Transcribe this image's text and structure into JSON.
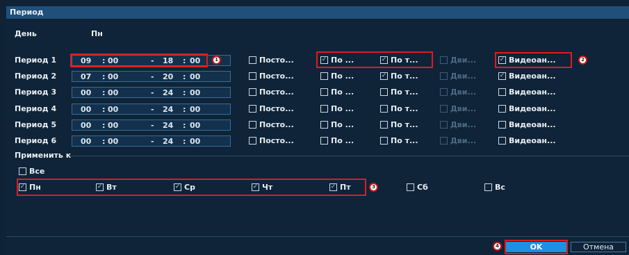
{
  "title": "Период",
  "day": {
    "label": "День",
    "value": "Пн"
  },
  "periods": [
    {
      "label": "Период 1",
      "from_h": "09",
      "from_m": "00",
      "to_h": "18",
      "to_m": "00",
      "checks": [
        false,
        true,
        true,
        false,
        true
      ]
    },
    {
      "label": "Период 2",
      "from_h": "07",
      "from_m": "00",
      "to_h": "20",
      "to_m": "00",
      "checks": [
        false,
        false,
        true,
        false,
        true
      ]
    },
    {
      "label": "Период 3",
      "from_h": "00",
      "from_m": "00",
      "to_h": "24",
      "to_m": "00",
      "checks": [
        false,
        false,
        false,
        false,
        false
      ]
    },
    {
      "label": "Период 4",
      "from_h": "00",
      "from_m": "00",
      "to_h": "24",
      "to_m": "00",
      "checks": [
        false,
        false,
        false,
        false,
        false
      ]
    },
    {
      "label": "Период 5",
      "from_h": "00",
      "from_m": "00",
      "to_h": "24",
      "to_m": "00",
      "checks": [
        false,
        false,
        false,
        false,
        false
      ]
    },
    {
      "label": "Период 6",
      "from_h": "00",
      "from_m": "00",
      "to_h": "24",
      "to_m": "00",
      "checks": [
        false,
        false,
        false,
        false,
        false
      ]
    }
  ],
  "record_types": [
    "Посто...",
    "По ...",
    "По т...",
    "Дви...",
    "Видеоан..."
  ],
  "record_types_disabled": [
    false,
    false,
    false,
    true,
    false
  ],
  "time_separator": ":",
  "time_dash": "-",
  "apply_to": {
    "label": "Применить к",
    "all": {
      "label": "Все",
      "checked": false
    },
    "days": [
      {
        "label": "Пн",
        "checked": true
      },
      {
        "label": "Вт",
        "checked": true
      },
      {
        "label": "Ср",
        "checked": true
      },
      {
        "label": "Чт",
        "checked": true
      },
      {
        "label": "Пт",
        "checked": true
      },
      {
        "label": "Сб",
        "checked": false
      },
      {
        "label": "Вс",
        "checked": false
      }
    ]
  },
  "markers": [
    "1",
    "2",
    "3",
    "4"
  ],
  "buttons": {
    "ok": "OK",
    "cancel": "Отмена"
  },
  "check_glyph": "✓",
  "colors": {
    "accent": "#1d8fe6",
    "highlight": "#e21b1b",
    "background": "#0f2236",
    "titlebar": "#1f4f7a"
  }
}
